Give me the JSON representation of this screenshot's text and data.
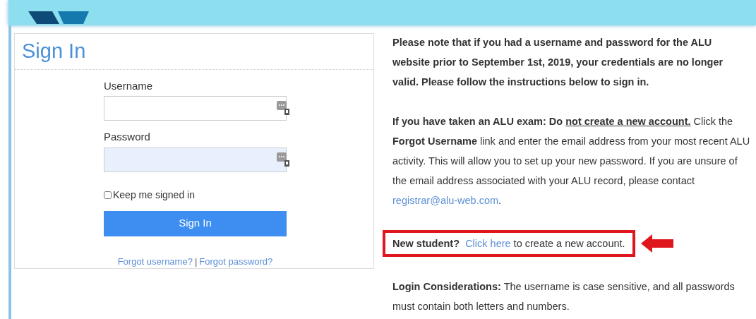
{
  "sign_in_panel": {
    "title": "Sign In",
    "fields": [
      {
        "label": "Username",
        "filled": false
      },
      {
        "label": "Password",
        "filled": true
      }
    ],
    "keep_signed_in": {
      "label": "Keep me signed in",
      "checked": false
    },
    "submit": "Sign In",
    "links": [
      "Forgot username?",
      "Forgot password?"
    ],
    "separator": "|"
  },
  "info": {
    "paragraphs": [
      {
        "segments": [
          {
            "kind": "bold",
            "text": "Please note that if you had a username and password for the ALU website prior to September 1st, 2019, your credentials are no longer valid. Please follow the instructions below to sign in."
          }
        ]
      },
      {
        "segments": [
          {
            "kind": "bold",
            "text": "If you have taken an ALU exam: Do "
          },
          {
            "kind": "bold-underline",
            "text": "not create a new account."
          },
          {
            "kind": "text",
            "text": " Click the "
          },
          {
            "kind": "bold",
            "text": "Forgot Username"
          },
          {
            "kind": "text",
            "text": " link and enter the email address from your most recent ALU activity. This will allow you to set up your new password. If you are unsure of the email address associated with your ALU record, please contact "
          },
          {
            "kind": "link",
            "text": "registrar@alu-web.com"
          },
          {
            "kind": "text",
            "text": "."
          }
        ]
      },
      {
        "highlighted": true,
        "segments": [
          {
            "kind": "bold",
            "text": "New student?  "
          },
          {
            "kind": "link",
            "text": "Click here"
          },
          {
            "kind": "text",
            "text": " to create a new account."
          }
        ]
      },
      {
        "segments": [
          {
            "kind": "bold",
            "text": "Login Considerations:"
          },
          {
            "kind": "text",
            "text": " The username is case sensitive, and all passwords must contain both letters and numbers."
          }
        ]
      }
    ]
  }
}
